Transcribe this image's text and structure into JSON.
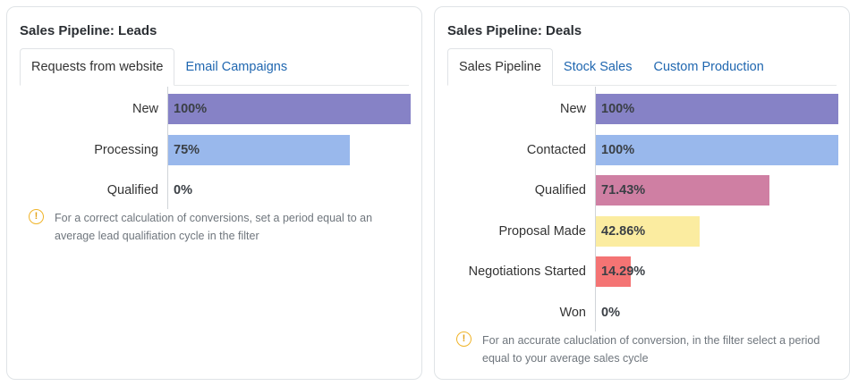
{
  "leads": {
    "title": "Sales Pipeline: Leads",
    "tabs": [
      {
        "label": "Requests from website",
        "active": true
      },
      {
        "label": "Email Campaigns",
        "active": false
      }
    ],
    "stages": [
      {
        "label": "New",
        "value": "100%",
        "fraction": 1.0,
        "color": "#8682c6"
      },
      {
        "label": "Processing",
        "value": "75%",
        "fraction": 0.75,
        "color": "#99b8ec"
      },
      {
        "label": "Qualified",
        "value": "0%",
        "fraction": 0.0,
        "color": "#99b8ec"
      }
    ],
    "note": {
      "icon": "exclamation-circle-icon",
      "text": "For a correct calculation of conversions, set a period equal to an average lead qualifiation cycle in the filter"
    }
  },
  "deals": {
    "title": "Sales Pipeline: Deals",
    "tabs": [
      {
        "label": "Sales Pipeline",
        "active": true
      },
      {
        "label": "Stock Sales",
        "active": false
      },
      {
        "label": "Custom Production",
        "active": false
      }
    ],
    "stages": [
      {
        "label": "New",
        "value": "100%",
        "fraction": 1.0,
        "color": "#8682c6"
      },
      {
        "label": "Contacted",
        "value": "100%",
        "fraction": 1.0,
        "color": "#99b8ec"
      },
      {
        "label": "Qualified",
        "value": "71.43%",
        "fraction": 0.7143,
        "color": "#cf7fa3"
      },
      {
        "label": "Proposal Made",
        "value": "42.86%",
        "fraction": 0.4286,
        "color": "#fbeca0"
      },
      {
        "label": "Negotiations Started",
        "value": "14.29%",
        "fraction": 0.1429,
        "color": "#f47474"
      },
      {
        "label": "Won",
        "value": "0%",
        "fraction": 0.0,
        "color": "#99b8ec"
      }
    ],
    "note": {
      "icon": "exclamation-circle-icon",
      "text": "For an accurate caluclation of conversion, in the filter select a period equal to your average sales cycle"
    }
  }
}
